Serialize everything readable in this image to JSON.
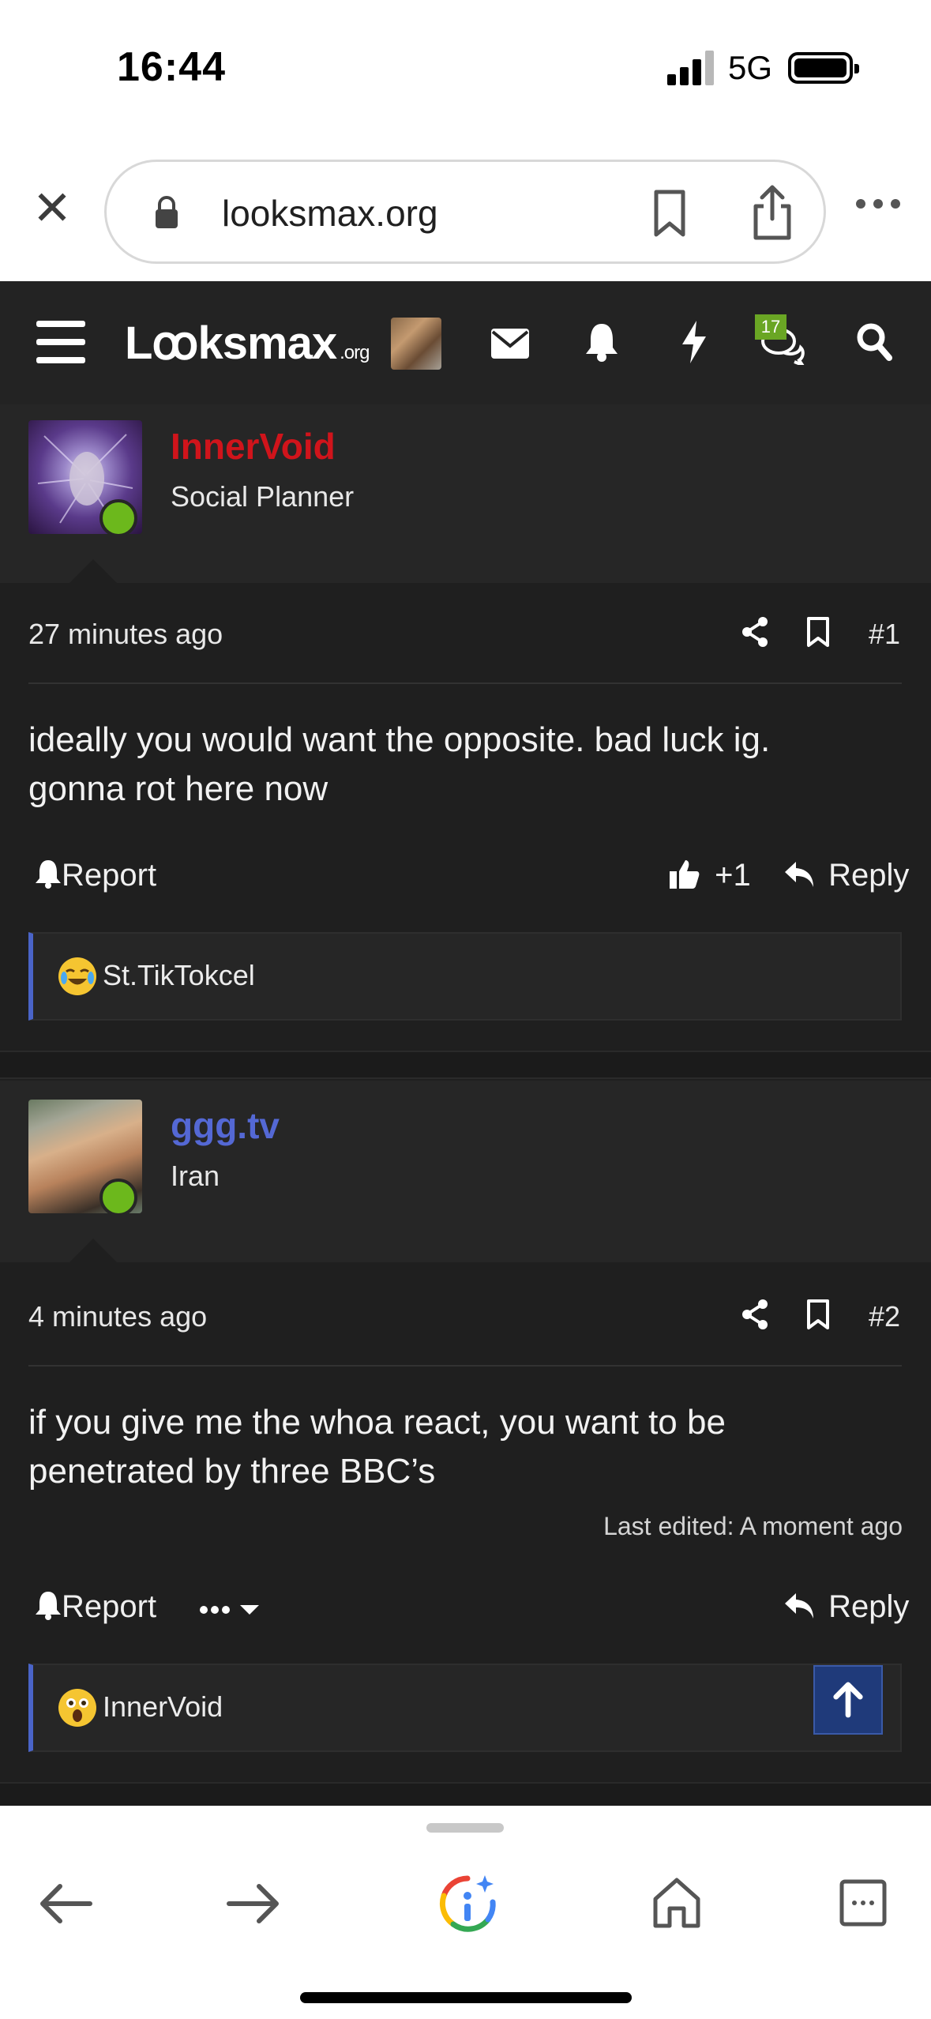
{
  "status_bar": {
    "time": "16:44",
    "network": "5G"
  },
  "browser": {
    "url": "looksmax.org"
  },
  "site_nav": {
    "logo_main": "Lꝏksmax",
    "logo_suffix": ".org",
    "conversations_badge": "17"
  },
  "posts": [
    {
      "username": "InnerVoid",
      "username_color": "#d0141b",
      "user_title": "Social Planner",
      "time_ago": "27 minutes ago",
      "post_number": "#1",
      "body_line1": "ideally you would want the opposite. bad luck ig.",
      "body_line2": "gonna rot here now",
      "report_label": "Report",
      "like_count": "+1",
      "reply_label": "Reply",
      "reaction_user": "St.TikTokcel",
      "reaction_emoji": "crying-laughing-emoji"
    },
    {
      "username": "ggg.tv",
      "username_color": "#5468d4",
      "user_title": "Iran",
      "time_ago": "4 minutes ago",
      "post_number": "#2",
      "body_line1": "if you give me the whoa react, you want to be",
      "body_line2": "penetrated by three BBC’s",
      "last_edited": "Last edited: A moment ago",
      "report_label": "Report",
      "reply_label": "Reply",
      "reaction_user": "InnerVoid",
      "reaction_emoji": "astonished-emoji"
    }
  ],
  "colors": {
    "forum_bg": "#1f1f1f",
    "nav_bg": "#232323",
    "online": "#6cb81c",
    "accent": "#4a64c8"
  }
}
